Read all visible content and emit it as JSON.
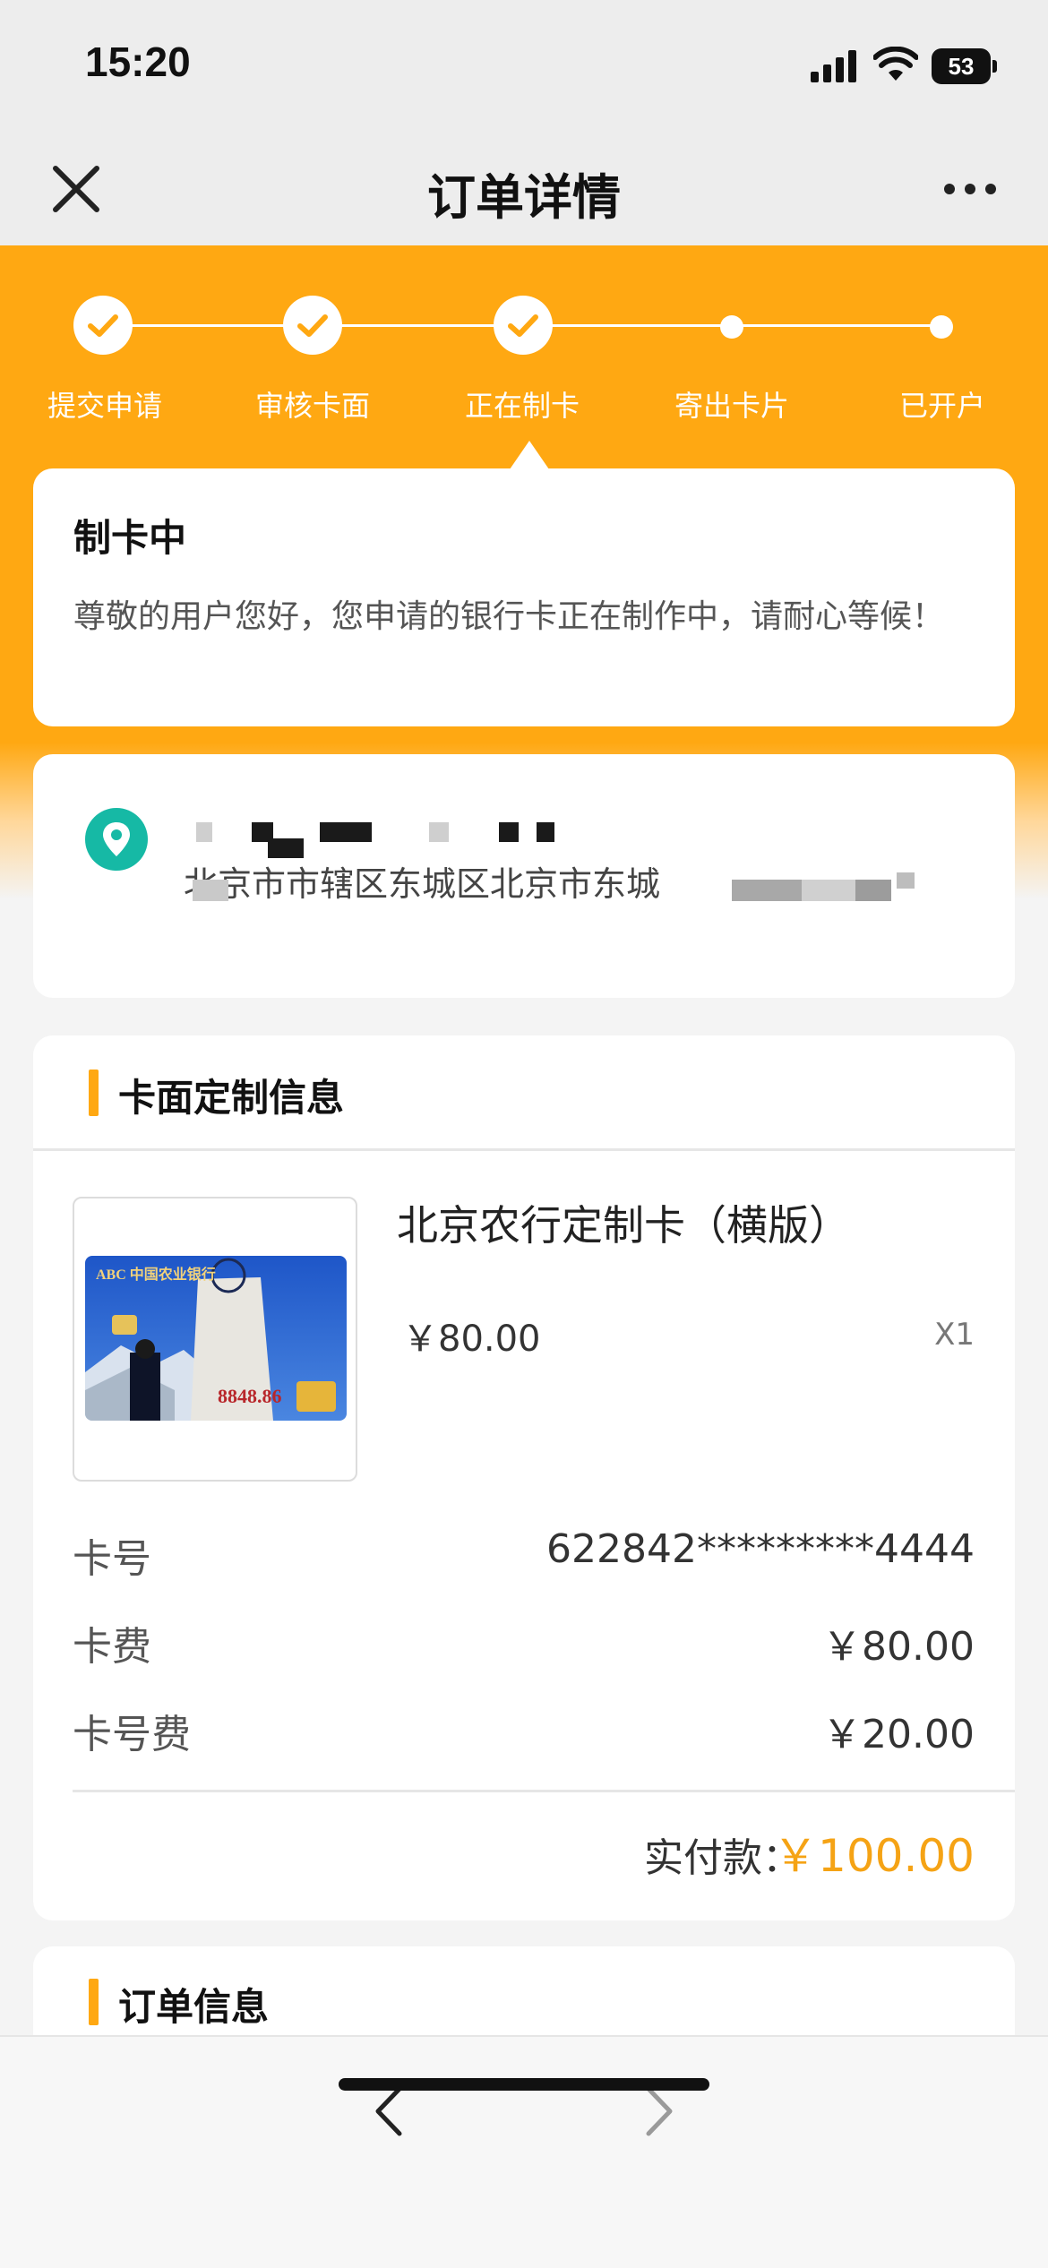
{
  "status_bar": {
    "time": "15:20",
    "battery": "53",
    "icons": [
      "signal-icon",
      "wifi-icon",
      "battery-icon"
    ]
  },
  "nav": {
    "title": "订单详情",
    "close_icon": "close-icon",
    "more_icon": "more-icon"
  },
  "progress": {
    "steps": [
      {
        "label": "提交申请",
        "done": true
      },
      {
        "label": "审核卡面",
        "done": true
      },
      {
        "label": "正在制卡",
        "done": true
      },
      {
        "label": "寄出卡片",
        "done": false
      },
      {
        "label": "已开户",
        "done": false
      }
    ]
  },
  "status_card": {
    "title": "制卡中",
    "description": "尊敬的用户您好，您申请的银行卡正在制作中，请耐心等候！"
  },
  "address_card": {
    "address": "北京市市辖区东城区北京市东城",
    "icon": "location-pin-icon"
  },
  "custom_card": {
    "section_title": "卡面定制信息",
    "product_name": "北京农行定制卡（横版）",
    "product_price": "￥80.00",
    "quantity": "X1",
    "card_image": {
      "bank_text": "ABC 中国农业银行",
      "number_text": "8848.86"
    },
    "rows": [
      {
        "label": "卡号",
        "value": "622842*********4444"
      },
      {
        "label": "卡费",
        "value": "￥80.00"
      },
      {
        "label": "卡号费",
        "value": "￥20.00"
      }
    ],
    "total_label": "实付款：",
    "total_value": "￥100.00",
    "accent_color": "#f5a315"
  },
  "order_card": {
    "section_title": "订单信息"
  },
  "bottom_bar": {
    "icons": [
      "back-arrow-icon",
      "forward-arrow-icon"
    ]
  },
  "theme": {
    "primary": "#ffa812",
    "background": "#f4f4f4"
  }
}
